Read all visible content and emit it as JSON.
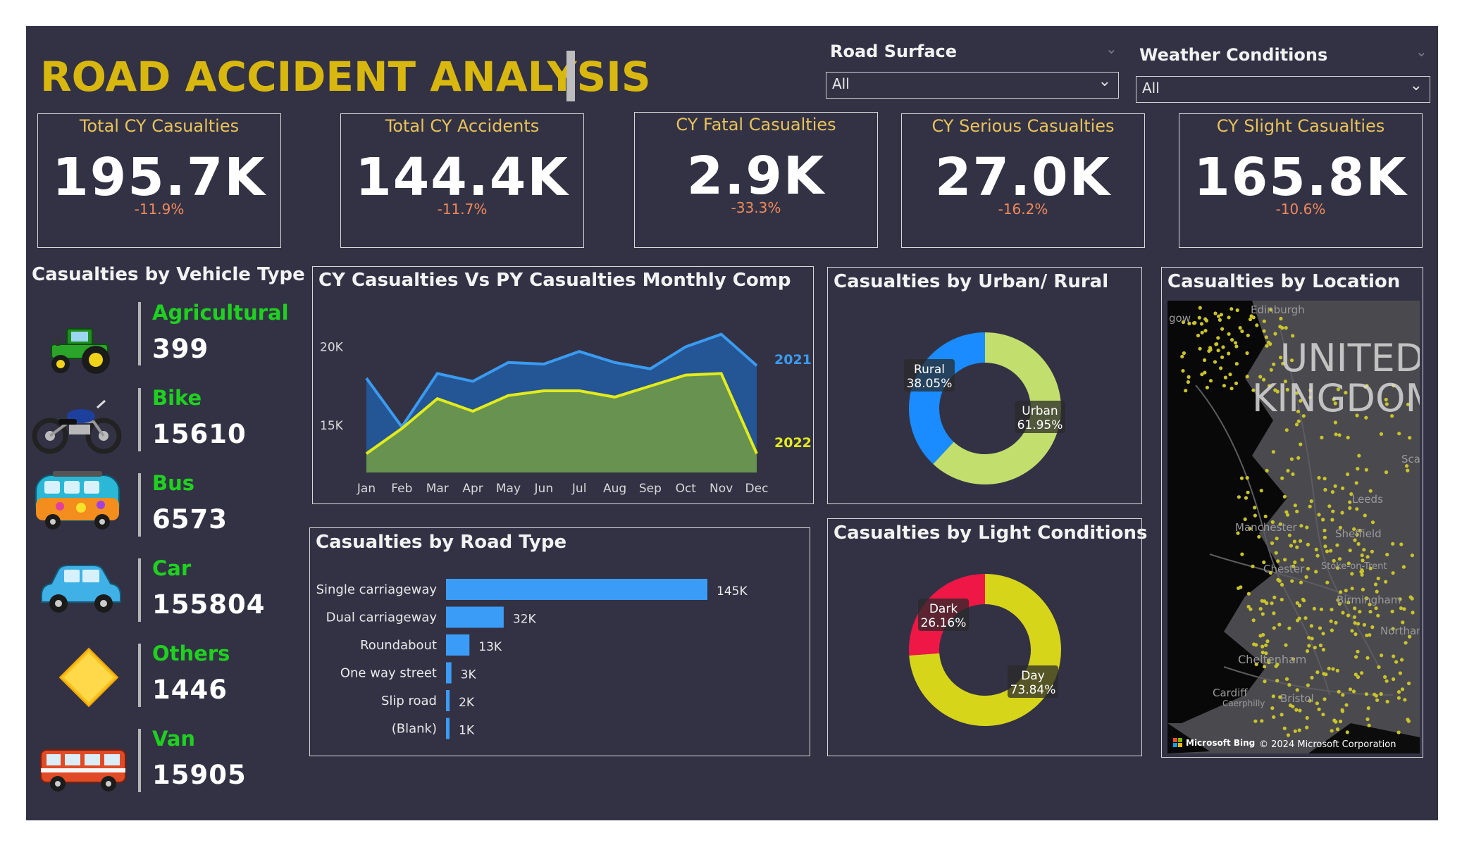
{
  "title": "ROAD ACCIDENT ANALYSIS",
  "slicers": {
    "road_surface": {
      "label": "Road Surface",
      "value": "All"
    },
    "weather": {
      "label": "Weather Conditions",
      "value": "All"
    }
  },
  "kpis": [
    {
      "label": "Total CY Casualties",
      "value": "195.7K",
      "delta": "-11.9%"
    },
    {
      "label": "Total CY Accidents",
      "value": "144.4K",
      "delta": "-11.7%"
    },
    {
      "label": "CY Fatal Casualties",
      "value": "2.9K",
      "delta": "-33.3%"
    },
    {
      "label": "CY Serious Casualties",
      "value": "27.0K",
      "delta": "-16.2%"
    },
    {
      "label": "CY Slight Casualties",
      "value": "165.8K",
      "delta": "-10.6%"
    }
  ],
  "vehicles": {
    "title": "Casualties by Vehicle Type",
    "items": [
      {
        "name": "Agricultural",
        "value": "399",
        "icon": "tractor-icon"
      },
      {
        "name": "Bike",
        "value": "15610",
        "icon": "motorbike-icon"
      },
      {
        "name": "Bus",
        "value": "6573",
        "icon": "bus-icon"
      },
      {
        "name": "Car",
        "value": "155804",
        "icon": "car-icon"
      },
      {
        "name": "Others",
        "value": "1446",
        "icon": "warning-sign-icon"
      },
      {
        "name": "Van",
        "value": "15905",
        "icon": "van-icon"
      }
    ]
  },
  "monthly": {
    "title": "CY Casualties Vs PY Casualties Monthly Comp",
    "chart_data": {
      "type": "area",
      "categories": [
        "Jan",
        "Feb",
        "Mar",
        "Apr",
        "May",
        "Jun",
        "Jul",
        "Aug",
        "Sep",
        "Oct",
        "Nov",
        "Dec"
      ],
      "series": [
        {
          "name": "2021",
          "values": [
            18000,
            14900,
            18300,
            17800,
            19000,
            18900,
            19700,
            19000,
            18600,
            20000,
            20800,
            18800
          ],
          "color": "#3a9bf0",
          "fill": "#245594"
        },
        {
          "name": "2022",
          "values": [
            13200,
            14800,
            16700,
            15900,
            16900,
            17200,
            17200,
            16800,
            17500,
            18200,
            18300,
            13200
          ],
          "color": "#e3ec1a",
          "fill": "#67924f"
        }
      ],
      "ylim": [
        12000,
        21500
      ],
      "yticks": [
        {
          "value": 15000,
          "label": "15K"
        },
        {
          "value": 20000,
          "label": "20K"
        }
      ]
    }
  },
  "urban": {
    "title": "Casualties by Urban/ Rural",
    "chart_data": {
      "type": "pie",
      "labels": [
        "Urban",
        "Rural"
      ],
      "values": [
        61.95,
        38.05
      ],
      "display": [
        "61.95%",
        "38.05%"
      ],
      "colors": [
        "#c2df6e",
        "#1a8cff"
      ]
    }
  },
  "light": {
    "title": "Casualties by Light Conditions",
    "chart_data": {
      "type": "pie",
      "labels": [
        "Day",
        "Dark"
      ],
      "values": [
        73.84,
        26.16
      ],
      "display": [
        "73.84%",
        "26.16%"
      ],
      "colors": [
        "#d7d51a",
        "#ef1745"
      ]
    }
  },
  "road_type": {
    "title": "Casualties by Road Type",
    "chart_data": {
      "type": "bar",
      "orientation": "horizontal",
      "categories": [
        "Single carriageway",
        "Dual carriageway",
        "Roundabout",
        "One way street",
        "Slip road",
        "(Blank)"
      ],
      "values": [
        145000,
        32000,
        13000,
        3000,
        2000,
        1000
      ],
      "labels": [
        "145K",
        "32K",
        "13K",
        "3K",
        "2K",
        "1K"
      ],
      "color": "#3b9cf7"
    }
  },
  "location": {
    "title": "Casualties by Location",
    "map_labels": {
      "country_line1": "UNITED",
      "country_line2": "KINGDOM",
      "edinburgh": "Edinburgh",
      "glasgow": "gow",
      "leeds": "Leeds",
      "manchester": "Manchester",
      "sheffield": "Sheffield",
      "chester": "Chester",
      "stoke": "Stoke-on-Trent",
      "birmingham": "Birmingham",
      "northampton": "Northamp",
      "cheltenham": "Cheltenham",
      "cardiff": "Cardiff",
      "bristol": "Bristol",
      "scarborough": "Scar",
      "caerphilly": "Caerphilly"
    },
    "attribution": {
      "brand": "Microsoft Bing",
      "copyright": "© 2024 Microsoft Corporation"
    }
  }
}
